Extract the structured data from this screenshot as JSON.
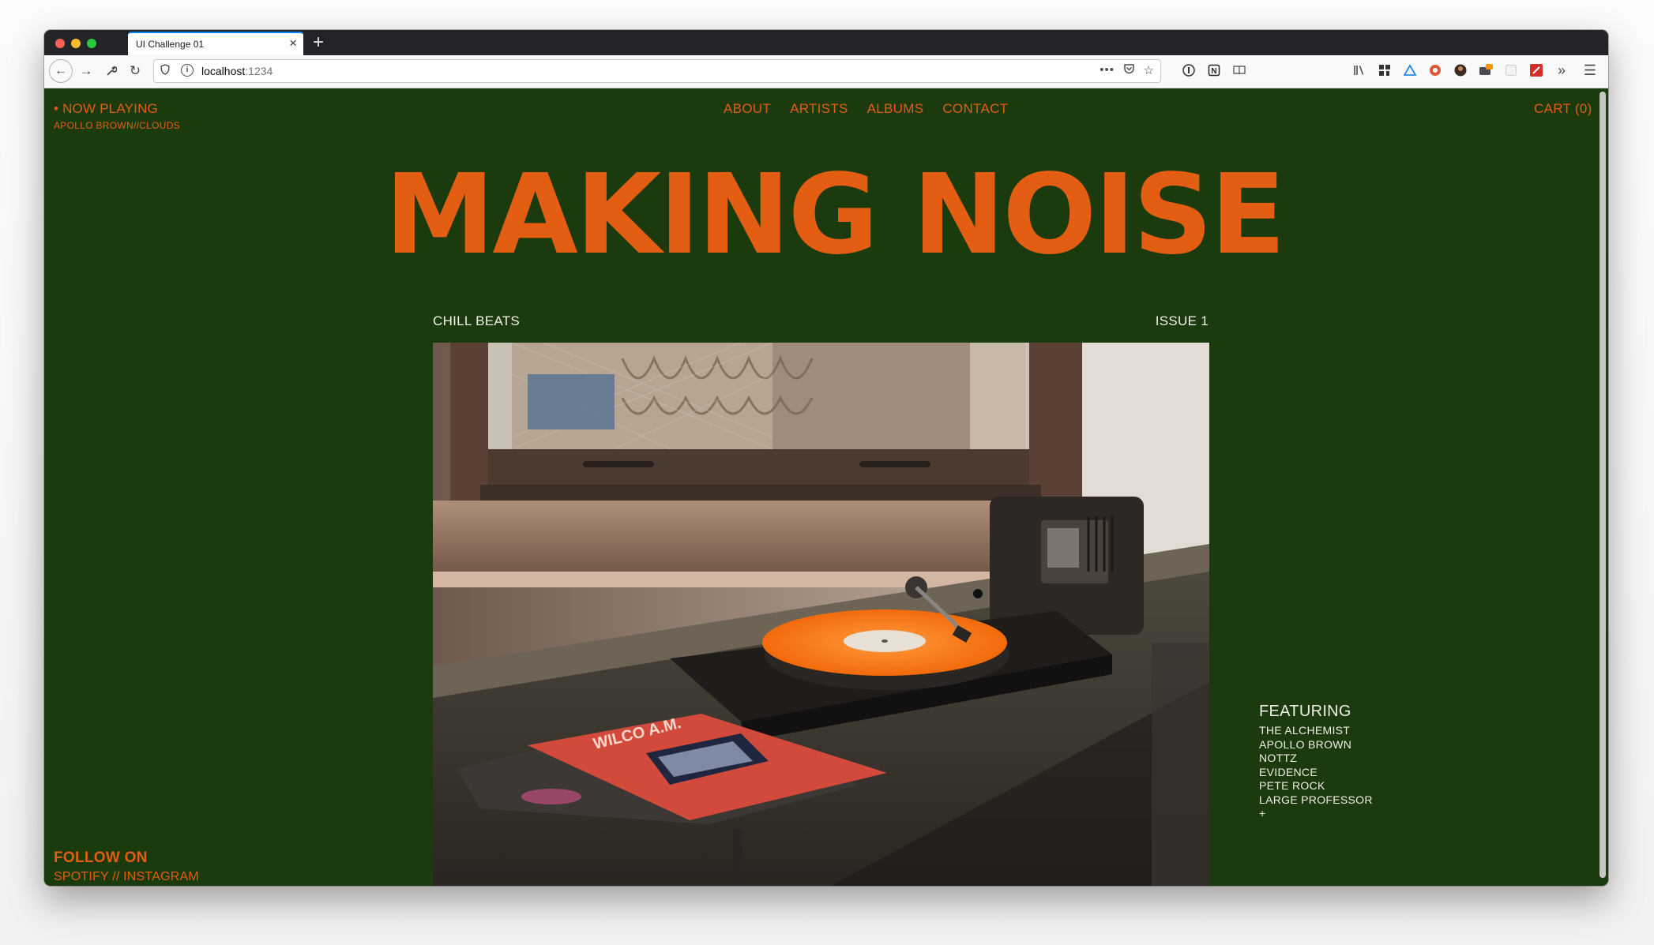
{
  "browser": {
    "tab_title": "UI Challenge 01",
    "tab_close": "×",
    "new_tab": "+",
    "url_host": "localhost",
    "url_port": ":1234"
  },
  "site": {
    "now_playing_label": "• NOW PLAYING",
    "now_playing_track": "APOLLO BROWN//CLOUDS",
    "nav": [
      "ABOUT",
      "ARTISTS",
      "ALBUMS",
      "CONTACT"
    ],
    "cart": "CART (0)",
    "title": "MAKING NOISE",
    "category": "CHILL BEATS",
    "issue": "ISSUE 1",
    "featuring_title": "FEATURING",
    "featuring": [
      "THE ALCHEMIST",
      "APOLLO BROWN",
      "NOTTZ",
      "EVIDENCE",
      "PETE ROCK",
      "LARGE PROFESSOR",
      "+"
    ],
    "follow_title": "FOLLOW ON",
    "follow_links": "SPOTIFY // INSTAGRAM",
    "record_cover_text": "WILCO  A.M.",
    "accent_color": "#e35d12",
    "background_color": "#1b3a0e"
  }
}
